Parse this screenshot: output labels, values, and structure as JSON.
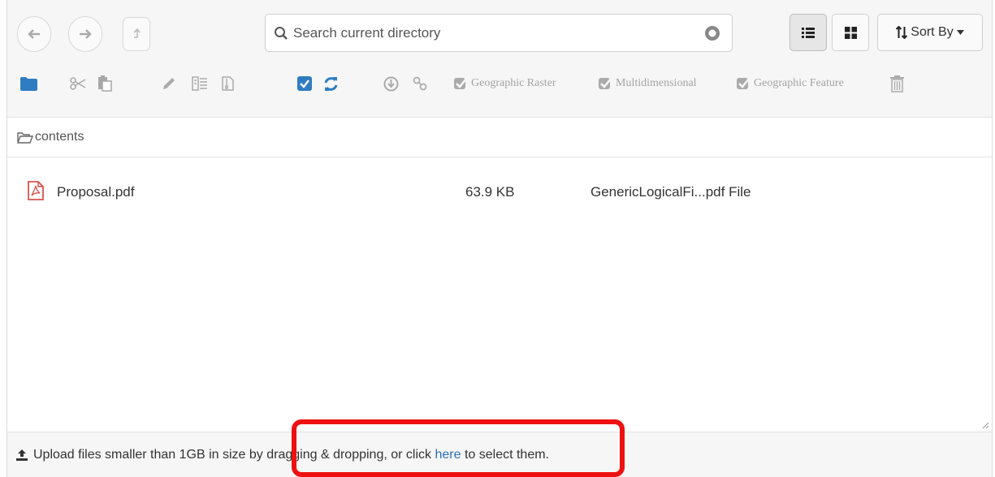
{
  "toolbar": {
    "search": {
      "placeholder": "Search current directory",
      "value": ""
    },
    "sort_label": "Sort By",
    "actions": {
      "geographic_raster": "Geographic Raster",
      "multidimensional": "Multidimensional",
      "geographic_feature": "Geographic Feature"
    }
  },
  "breadcrumb": {
    "folder": "contents"
  },
  "files": [
    {
      "name": "Proposal.pdf",
      "size": "63.9 KB",
      "type": "GenericLogicalFi...pdf File",
      "icon": "pdf-file-icon"
    }
  ],
  "upload": {
    "text_before": "Upload files smaller than 1GB in size by dragging & dropping, or click ",
    "link": "here",
    "text_after": " to select them."
  },
  "colors": {
    "accent": "#2a6eb8",
    "folder_blue": "#2f7dc1",
    "pdf_red": "#d9534f",
    "disabled_gray": "#a3a3a3",
    "highlight_red": "#ee1111"
  },
  "icons": [
    "arrow-left-icon",
    "arrow-right-icon",
    "arrow-up-icon",
    "search-icon",
    "clear-icon",
    "list-view-icon",
    "grid-view-icon",
    "sort-icon",
    "folder-icon",
    "cut-icon",
    "paste-icon",
    "edit-icon",
    "metadata-icon",
    "zip-icon",
    "checkbox-icon",
    "refresh-icon",
    "download-icon",
    "link-icon",
    "check-icon",
    "trash-icon",
    "folder-open-icon",
    "upload-icon"
  ]
}
